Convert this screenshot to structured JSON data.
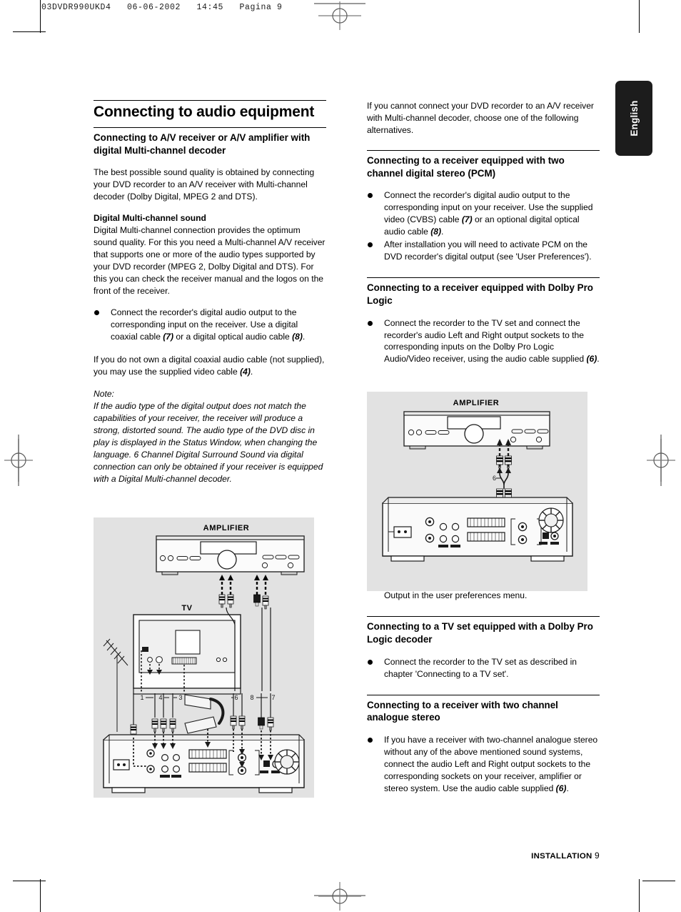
{
  "prepress": {
    "slug": "03DVDR990UKD4   06-06-2002   14:45   Pagina 9"
  },
  "lang_tab": {
    "label": "English"
  },
  "footer": {
    "section": "INSTALLATION",
    "page": "9"
  },
  "left_column": {
    "title": "Connecting to audio equipment",
    "section1_heading": "Connecting to A/V receiver or A/V amplifier with digital Multi-channel decoder",
    "intro": "The best possible sound quality is obtained by connecting your DVD recorder to an A/V receiver with Multi-channel decoder (Dolby Digital, MPEG 2 and DTS).",
    "sub1_heading": "Digital Multi-channel sound",
    "sub1_body": "Digital Multi-channel connection provides the optimum sound quality. For this you need a Multi-channel A/V receiver that supports one or more of the audio types supported by your DVD recorder (MPEG 2, Dolby Digital and DTS). For this you can check the receiver manual and the logos on the front of the receiver.",
    "bullet1_a": "Connect the recorder's digital audio output to the corresponding input on the receiver. Use a digital coaxial cable ",
    "bullet1_ref1": "(7)",
    "bullet1_b": " or a digital optical audio cable ",
    "bullet1_ref2": "(8)",
    "bullet1_c": ".",
    "para_cable_a": "If you do not own a digital coaxial audio cable (not supplied), you may use the supplied video cable ",
    "para_cable_ref": "(4)",
    "para_cable_b": ".",
    "note_label": "Note:",
    "note_body": "If the audio type of the digital output does not match the capabilities of your receiver, the receiver will produce a strong, distorted sound. The audio type of the DVD disc in play is displayed in the Status Window, when changing the language. 6 Channel Digital Surround Sound via digital connection can only be obtained if your receiver is equipped with a Digital Multi-channel decoder."
  },
  "right_column": {
    "intro": "If you cannot connect your DVD recorder to an A/V receiver with Multi-channel decoder, choose one of the following alternatives.",
    "section_pcm_heading": "Connecting to a receiver equipped with two channel digital stereo (PCM)",
    "pcm_bullet1_a": "Connect the recorder's digital audio output to the corresponding input on your receiver. Use the supplied video (CVBS) cable ",
    "pcm_bullet1_ref1": "(7)",
    "pcm_bullet1_b": " or an optional digital optical audio cable ",
    "pcm_bullet1_ref2": "(8)",
    "pcm_bullet1_c": ".",
    "pcm_bullet2": "After installation you will need to activate PCM on the DVD recorder's digital output (see 'User Preferences').",
    "section_prologic_heading": "Connecting to a receiver equipped with Dolby Pro Logic",
    "prologic_bullet_a": "Connect the recorder to the TV set and connect the recorder's audio Left and Right output sockets to the corresponding inputs on the Dolby Pro Logic Audio/Video receiver, using the audio cable supplied ",
    "prologic_bullet_ref": "(6)",
    "prologic_bullet_b": ".",
    "sound_settings_bullet": "Make the appropriate Sound settings for Analogue Output in the user preferences menu.",
    "section_tvset_heading": "Connecting to a TV set equipped with a Dolby Pro Logic decoder",
    "tvset_bullet": "Connect the recorder to the TV set as described in chapter 'Connecting to a TV set'.",
    "section_analogue_heading": "Connecting to a receiver with two channel analogue stereo",
    "analogue_bullet_a": "If you have a receiver with two-channel analogue stereo without any of the above mentioned sound systems, connect the audio Left and Right output sockets to the corresponding sockets on your receiver, amplifier or stereo system. Use the audio cable supplied ",
    "analogue_bullet_ref": "(6)",
    "analogue_bullet_b": "."
  },
  "figure_left": {
    "caption_amplifier": "AMPLIFIER",
    "caption_tv": "TV",
    "cable_labels": [
      "1",
      "4",
      "3",
      "6",
      "8",
      "7"
    ],
    "background_color": "#e2e2e2"
  },
  "figure_right": {
    "caption_amplifier": "AMPLIFIER",
    "cable_labels": [
      "6"
    ],
    "background_color": "#e2e2e2"
  }
}
